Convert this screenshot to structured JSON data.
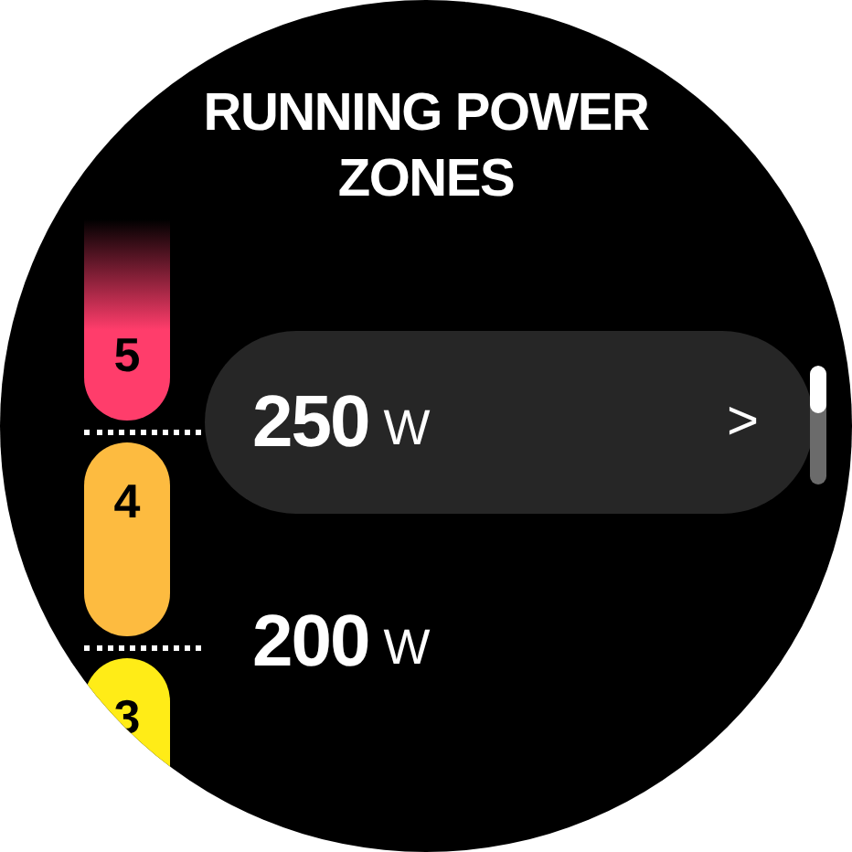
{
  "title": "RUNNING POWER ZONES",
  "zones": [
    {
      "label": "5",
      "color": "#ff3d6b"
    },
    {
      "label": "4",
      "color": "#fdbb40"
    },
    {
      "label": "3",
      "color": "#ffec17"
    }
  ],
  "rows": [
    {
      "value": "250",
      "unit": "W",
      "selected": true,
      "chevron": ">"
    },
    {
      "value": "200",
      "unit": "W",
      "selected": false
    }
  ]
}
